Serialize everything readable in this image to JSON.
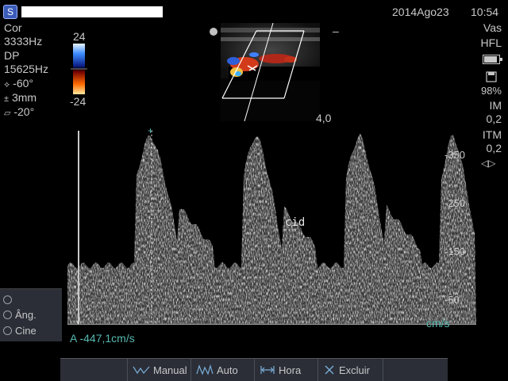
{
  "header": {
    "date": "2014Ago23",
    "time": "10:54"
  },
  "left_params": {
    "mode": "Cor",
    "prf": "3333Hz",
    "doppler_mode": "DP",
    "doppler_prf": "15625Hz",
    "angle": "-60°",
    "gate": "3mm",
    "steer": "-20°"
  },
  "color_scale": {
    "top": "24",
    "bottom": "-24"
  },
  "depth": "4,0",
  "right_params": {
    "app": "Vas",
    "probe": "HFL",
    "storage_pct": "98%",
    "mi_label": "IM",
    "mi_value": "0,2",
    "itm_label": "ITM",
    "itm_value": "0,2"
  },
  "spectrum": {
    "annotation": "cid",
    "units": "cm/s",
    "ticks": [
      "-350",
      "-250",
      "-150",
      "-50"
    ],
    "tick_values": [
      -350,
      -250,
      -150,
      -50
    ],
    "velocity_range": [
      0,
      -400
    ],
    "velocity_readout": "A  -447,1cm/s"
  },
  "side_menu": {
    "items": [
      "Âng.",
      "Cine"
    ]
  },
  "softkeys": {
    "manual": "Manual",
    "auto": "Auto",
    "hora": "Hora",
    "excluir": "Excluir"
  },
  "colors": {
    "accent": "#56b9b0",
    "panel": "#2b2e37"
  }
}
